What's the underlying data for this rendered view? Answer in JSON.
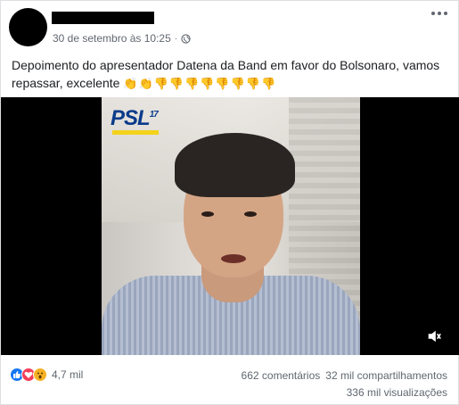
{
  "post": {
    "timestamp": "30 de setembro às 10:25",
    "separator": "·",
    "text": "Depoimento do apresentador Datena da Band em favor do Bolsonaro, vamos repassar, excelente",
    "emojis": [
      "👏",
      "👏",
      "👎",
      "👎",
      "👎",
      "👎",
      "👎",
      "👎",
      "👎",
      "👎"
    ]
  },
  "video": {
    "logo_text": "PSL",
    "logo_number": "17"
  },
  "footer": {
    "reactions": [
      "like",
      "love",
      "wow"
    ],
    "reaction_count": "4,7 mil",
    "comments": "662 comentários",
    "shares": "32 mil compartilhamentos",
    "views": "336 mil visualizações"
  },
  "colors": {
    "like": "#1877f2",
    "love": "#f33e58",
    "wow": "#f7b125",
    "meta_text": "#616770"
  }
}
